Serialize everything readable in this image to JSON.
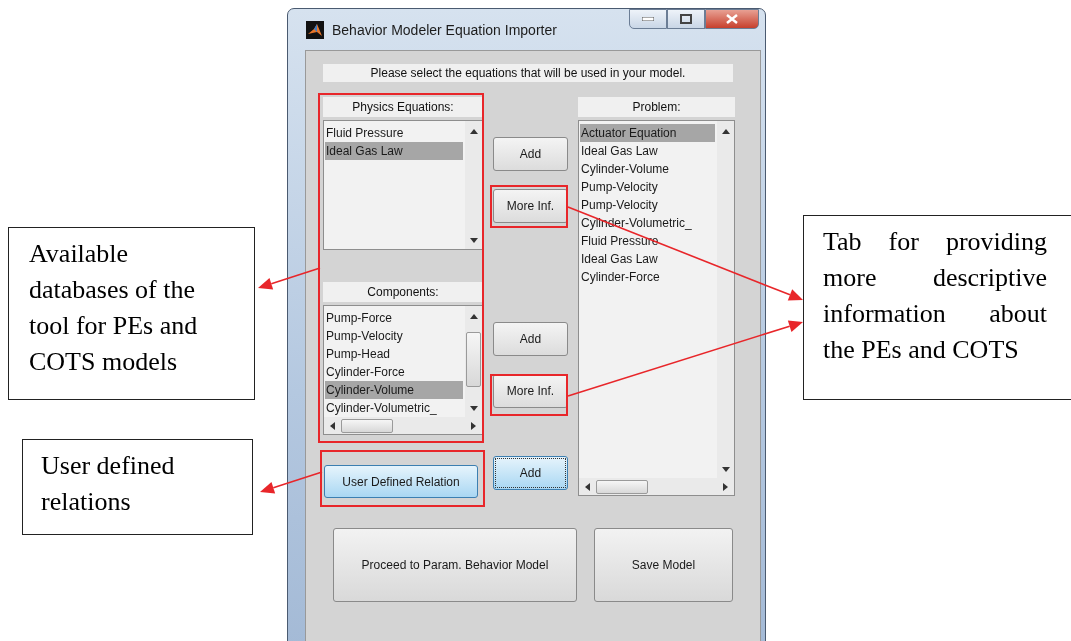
{
  "window": {
    "title": "Behavior Modeler Equation Importer"
  },
  "instruction": "Please select the equations that will be used in your model.",
  "lists": [
    {
      "header": "Physics Equations:",
      "horizontal_scrollbar": false,
      "items": [
        {
          "label": "Fluid Pressure",
          "selected": false
        },
        {
          "label": "Ideal Gas Law",
          "selected": true
        }
      ]
    },
    {
      "header": "Components:",
      "horizontal_scrollbar": true,
      "items": [
        {
          "label": "Pump-Force",
          "selected": false
        },
        {
          "label": "Pump-Velocity",
          "selected": false
        },
        {
          "label": "Pump-Head",
          "selected": false
        },
        {
          "label": "Cylinder-Force",
          "selected": false
        },
        {
          "label": "Cylinder-Volume",
          "selected": true
        },
        {
          "label": "Cylinder-Volumetric_",
          "selected": false
        }
      ]
    },
    {
      "header": "Problem:",
      "horizontal_scrollbar": true,
      "items": [
        {
          "label": "Actuator Equation",
          "selected": true
        },
        {
          "label": "Ideal Gas Law",
          "selected": false
        },
        {
          "label": "Cylinder-Volume",
          "selected": false
        },
        {
          "label": "Pump-Velocity",
          "selected": false
        },
        {
          "label": "Pump-Velocity",
          "selected": false
        },
        {
          "label": "Cylinder-Volumetric_",
          "selected": false
        },
        {
          "label": "Fluid Pressure",
          "selected": false
        },
        {
          "label": "Ideal Gas Law",
          "selected": false
        },
        {
          "label": "Cylinder-Force",
          "selected": false
        }
      ]
    }
  ],
  "side_buttons": [
    {
      "label": "Add",
      "focused": false
    },
    {
      "label": "More Inf.",
      "focused": false
    },
    {
      "label": "Add",
      "focused": false
    },
    {
      "label": "More Inf.",
      "focused": false
    },
    {
      "label": "Add",
      "focused": true
    }
  ],
  "user_defined_button": {
    "label": "User Defined Relation",
    "focused": true
  },
  "bottom_buttons": [
    "Proceed to Param. Behavior Model",
    "Save Model"
  ],
  "annotations": [
    {
      "text": "Available databases of the tool for PEs and COTS models"
    },
    {
      "text": "User defined relations"
    },
    {
      "text": "Tab for providing more descriptive information about the PEs and COTS"
    }
  ]
}
